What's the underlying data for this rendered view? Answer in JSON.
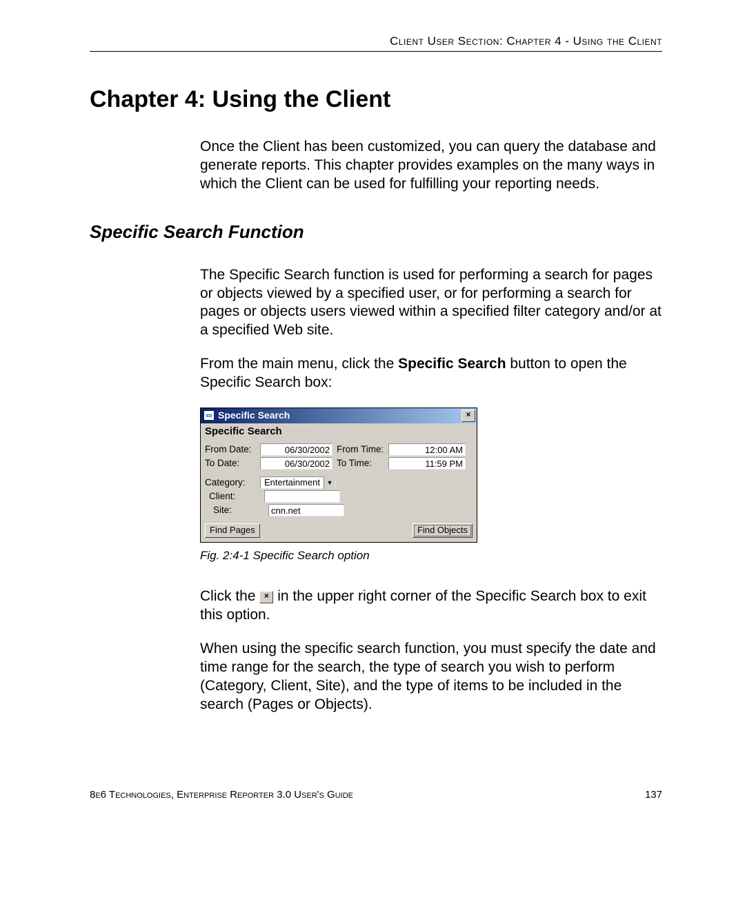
{
  "header": {
    "running": "Client User Section: Chapter 4 - Using the Client"
  },
  "chapter": {
    "title": "Chapter 4: Using the Client",
    "intro": "Once the Client has been customized, you can query the database and generate reports. This chapter provides examples on the many ways in which the Client can be used for fulfilling your reporting needs."
  },
  "section": {
    "title": "Specific Search Function",
    "p1": "The Specific Search function is used for performing a search for pages or objects viewed by a specified user, or for performing a search for pages or objects users viewed within a specified filter category and/or at a specified Web site.",
    "p2a": "From the main menu, click the ",
    "p2b_bold": "Specific Search",
    "p2c": " button to open the Specific Search box:",
    "p3a": "Click the ",
    "p3b": " in the upper right corner of the Specific Search box to exit this option.",
    "p4": "When using the specific search function, you must specify the date and time range for the search, the type of search you wish to perform (Category, Client, Site), and the type of items to be included in the search (Pages or Objects)."
  },
  "dialog": {
    "titlebar": "Specific Search",
    "subtitle": "Specific Search",
    "labels": {
      "from_date": "From Date:",
      "to_date": "To Date:",
      "from_time": "From Time:",
      "to_time": "To Time:",
      "category": "Category:",
      "client": "Client:",
      "site": "Site:"
    },
    "values": {
      "from_date": "06/30/2002",
      "to_date": "06/30/2002",
      "from_time": "12:00 AM",
      "to_time": "11:59 PM",
      "category": "Entertainment",
      "client": "",
      "site": "cnn.net"
    },
    "buttons": {
      "find_pages": "Find Pages",
      "find_objects": "Find Objects"
    }
  },
  "figure_caption": "Fig. 2:4-1  Specific Search option",
  "footer": {
    "left": "8e6 Technologies, Enterprise Reporter 3.0 User's Guide",
    "right": "137"
  }
}
